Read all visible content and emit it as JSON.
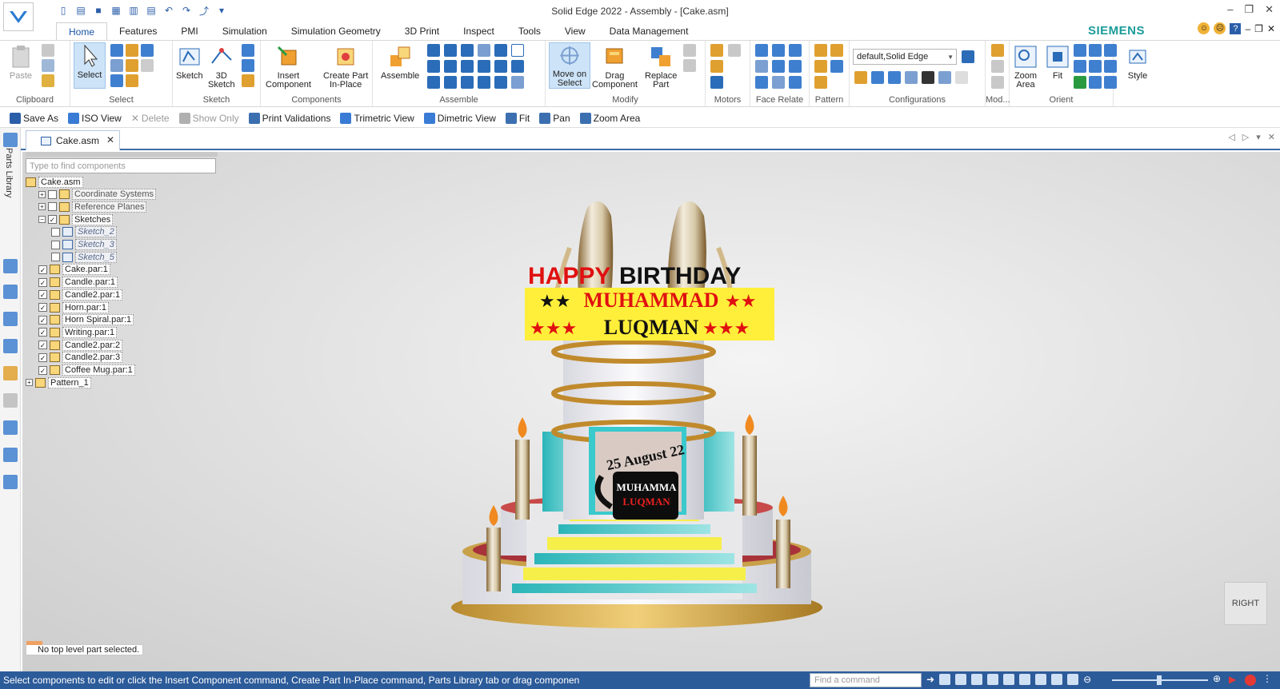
{
  "window": {
    "title": "Solid Edge 2022 - Assembly - [Cake.asm]",
    "brand": "SIEMENS",
    "controls": [
      "–",
      "❐",
      "✕"
    ],
    "help_controls": [
      "?",
      "–",
      "❐",
      "✕"
    ]
  },
  "ribbon_tabs": [
    "Home",
    "Features",
    "PMI",
    "Simulation",
    "Simulation Geometry",
    "3D Print",
    "Inspect",
    "Tools",
    "View",
    "Data Management"
  ],
  "ribbon": {
    "clipboard": {
      "label": "Clipboard",
      "paste": "Paste"
    },
    "select": {
      "label": "Select",
      "select_btn": "Select"
    },
    "sketch": {
      "label": "Sketch",
      "sketch_btn": "Sketch",
      "sketch3d_line1": "3D",
      "sketch3d_line2": "Sketch"
    },
    "components": {
      "label": "Components",
      "insert_line1": "Insert",
      "insert_line2": "Component",
      "create_line1": "Create Part",
      "create_line2": "In-Place"
    },
    "assemble": {
      "label": "Assemble",
      "assemble_btn": "Assemble"
    },
    "modify": {
      "label": "Modify",
      "move_line1": "Move on",
      "move_line2": "Select",
      "drag_line1": "Drag",
      "drag_line2": "Component",
      "replace_line1": "Replace",
      "replace_line2": "Part"
    },
    "motors": {
      "label": "Motors"
    },
    "face_relate": {
      "label": "Face Relate"
    },
    "pattern": {
      "label": "Pattern"
    },
    "configurations": {
      "label": "Configurations",
      "combo_value": "default,Solid Edge"
    },
    "modify2": {
      "label": "Mod..."
    },
    "orient": {
      "label": "Orient",
      "zoom_line1": "Zoom",
      "zoom_line2": "Area",
      "fit": "Fit"
    },
    "style": {
      "label": "Style"
    }
  },
  "command_bar": [
    {
      "label": "Save As",
      "enabled": true,
      "icon": "save-as-icon",
      "color": "#2b5ea8"
    },
    {
      "label": "ISO View",
      "enabled": true,
      "icon": "iso-view-icon",
      "color": "#3a7bd5"
    },
    {
      "label": "Delete",
      "enabled": false,
      "icon": "delete-icon",
      "color": "#b0b0b0"
    },
    {
      "label": "Show Only",
      "enabled": false,
      "icon": "show-only-icon",
      "color": "#b0b0b0"
    },
    {
      "label": "Print Validations",
      "enabled": true,
      "icon": "print-validations-icon",
      "color": "#3c6fb0"
    },
    {
      "label": "Trimetric View",
      "enabled": true,
      "icon": "trimetric-view-icon",
      "color": "#3a7bd5"
    },
    {
      "label": "Dimetric View",
      "enabled": true,
      "icon": "dimetric-view-icon",
      "color": "#3a7bd5"
    },
    {
      "label": "Fit",
      "enabled": true,
      "icon": "fit-icon",
      "color": "#3c6fb0"
    },
    {
      "label": "Pan",
      "enabled": true,
      "icon": "pan-icon",
      "color": "#3c6fb0"
    },
    {
      "label": "Zoom Area",
      "enabled": true,
      "icon": "zoom-area-icon",
      "color": "#3c6fb0"
    }
  ],
  "side_panel": {
    "parts_library": "Parts Library"
  },
  "document_tab": {
    "name": "Cake.asm",
    "close": "✕",
    "nav": [
      "◁",
      "▷",
      "▾",
      "✕"
    ]
  },
  "pathfinder": {
    "search_placeholder": "Type to find components",
    "items": [
      {
        "label": "Cake.asm",
        "expander": "",
        "checkbox": "",
        "style": "normal"
      },
      {
        "label": "Coordinate Systems",
        "expander": "+",
        "checkbox": " ",
        "style": "dim"
      },
      {
        "label": "Reference Planes",
        "expander": "+",
        "checkbox": " ",
        "style": "dim"
      },
      {
        "label": "Sketches",
        "expander": "−",
        "checkbox": "✓",
        "style": "normal"
      },
      {
        "label": "Sketch_2",
        "expander": "",
        "checkbox": " ",
        "style": "ital"
      },
      {
        "label": "Sketch_3",
        "expander": "",
        "checkbox": " ",
        "style": "ital"
      },
      {
        "label": "Sketch_5",
        "expander": "",
        "checkbox": " ",
        "style": "ital"
      },
      {
        "label": "Cake.par:1",
        "expander": "",
        "checkbox": "✓",
        "style": "normal"
      },
      {
        "label": "Candle.par:1",
        "expander": "",
        "checkbox": "✓",
        "style": "normal"
      },
      {
        "label": "Candle2.par:1",
        "expander": "",
        "checkbox": "✓",
        "style": "normal"
      },
      {
        "label": "Horn.par:1",
        "expander": "",
        "checkbox": "✓",
        "style": "normal"
      },
      {
        "label": "Horn Spiral.par:1",
        "expander": "",
        "checkbox": "✓",
        "style": "normal"
      },
      {
        "label": "Writing.par:1",
        "expander": "",
        "checkbox": "✓",
        "style": "normal"
      },
      {
        "label": "Candle2.par:2",
        "expander": "",
        "checkbox": "✓",
        "style": "normal"
      },
      {
        "label": "Candle2.par:3",
        "expander": "",
        "checkbox": "✓",
        "style": "normal"
      },
      {
        "label": "Coffee Mug.par:1",
        "expander": "",
        "checkbox": "✓",
        "style": "normal"
      },
      {
        "label": "Pattern_1",
        "expander": "+",
        "checkbox": "",
        "style": "normal"
      }
    ]
  },
  "model": {
    "banner_happy": "HAPPY",
    "banner_birthday": "BIRTHDAY",
    "banner_line2": "MUHAMMAD",
    "banner_line3": "LUQMAN",
    "mug_top": "MUHAMMA",
    "mug_bottom": "LUQMAN",
    "mug_arc": "25 August 22",
    "stars2_left": "★★",
    "stars2_right": "★★",
    "stars3_left": "★★★",
    "stars3_right": "★★★"
  },
  "view_cube": {
    "label": "RIGHT"
  },
  "status_tag": "No top level part selected.",
  "status_bar": {
    "prompt": "Select components to edit or click the Insert Component command, Create Part In-Place command, Parts Library tab or drag componen",
    "find_placeholder": "Find a command"
  },
  "colors": {
    "accent": "#2c5b9a",
    "brand": "#199c9a",
    "banner_yellow": "#ffef3a",
    "banner_red": "#e01010"
  }
}
